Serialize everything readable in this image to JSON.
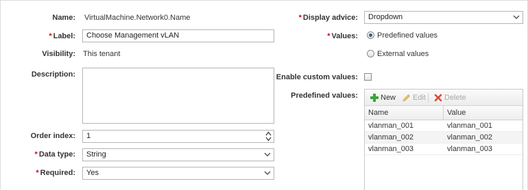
{
  "form": {
    "name_label": "Name:",
    "name_value": "VirtualMachine.Network0.Name",
    "label_label": "Label:",
    "label_value": "Choose Management vLAN",
    "visibility_label": "Visibility:",
    "visibility_value": "This tenant",
    "description_label": "Description:",
    "description_value": "",
    "order_index_label": "Order index:",
    "order_index_value": "1",
    "data_type_label": "Data type:",
    "data_type_value": "String",
    "required_label": "Required:",
    "required_value": "Yes",
    "required_marker": "*"
  },
  "right": {
    "display_advice_label": "Display advice:",
    "display_advice_value": "Dropdown",
    "values_label": "Values:",
    "values_options": [
      "Predefined values",
      "External values"
    ],
    "values_selected": "Predefined values",
    "enable_custom_label": "Enable custom values:",
    "enable_custom_checked": false,
    "predefined_label": "Predefined values:"
  },
  "grid": {
    "toolbar": {
      "new": "New",
      "edit": "Edit",
      "delete": "Delete"
    },
    "columns": [
      "Name",
      "Value"
    ],
    "rows": [
      [
        "vlanman_001",
        "vlanman_001"
      ],
      [
        "vlanman_002",
        "vlanman_002"
      ],
      [
        "vlanman_003",
        "vlanman_003"
      ]
    ]
  },
  "colors": {
    "required": "#d0021b",
    "radio_selected": "#2d5f99",
    "add_icon": "#3aa63a",
    "delete_icon": "#d84a3a",
    "disabled_text": "#a8a8a8"
  },
  "icons": {
    "add": "plus-icon",
    "edit": "pencil-icon",
    "delete": "x-icon",
    "dropdown": "chevron-down-icon",
    "spinner": "spinner-arrows-icon"
  }
}
